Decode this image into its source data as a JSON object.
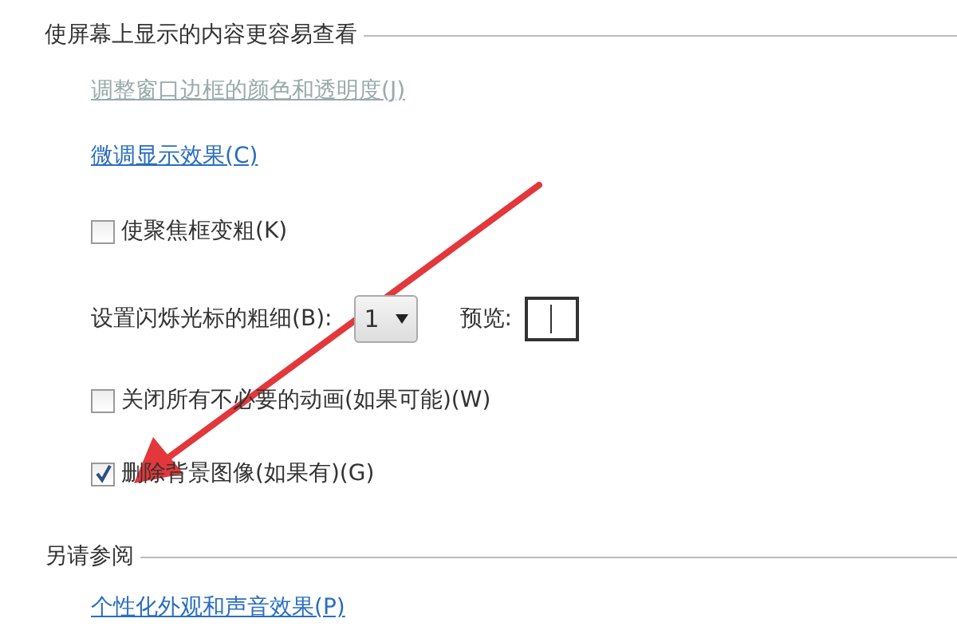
{
  "section": {
    "title": "使屏幕上显示的内容更容易查看"
  },
  "links": [
    {
      "text": "调整窗口边框的颜色和透明度(J)",
      "disabled": true
    },
    {
      "text": "微调显示效果(C)",
      "disabled": false
    }
  ],
  "options": [
    {
      "kind": "checkbox",
      "label": "使聚焦框变粗(K)",
      "checked": false
    },
    {
      "kind": "dropdown",
      "label": "设置闪烁光标的粗细(B):",
      "value": "1",
      "preview_label": "预览:"
    },
    {
      "kind": "checkbox",
      "label": "关闭所有不必要的动画(如果可能)(W)",
      "checked": false
    },
    {
      "kind": "checkbox",
      "label": "删除背景图像(如果有)(G)",
      "checked": true
    }
  ],
  "see_also": {
    "title": "另请参阅",
    "links": [
      "个性化外观和声音效果(P)"
    ]
  }
}
